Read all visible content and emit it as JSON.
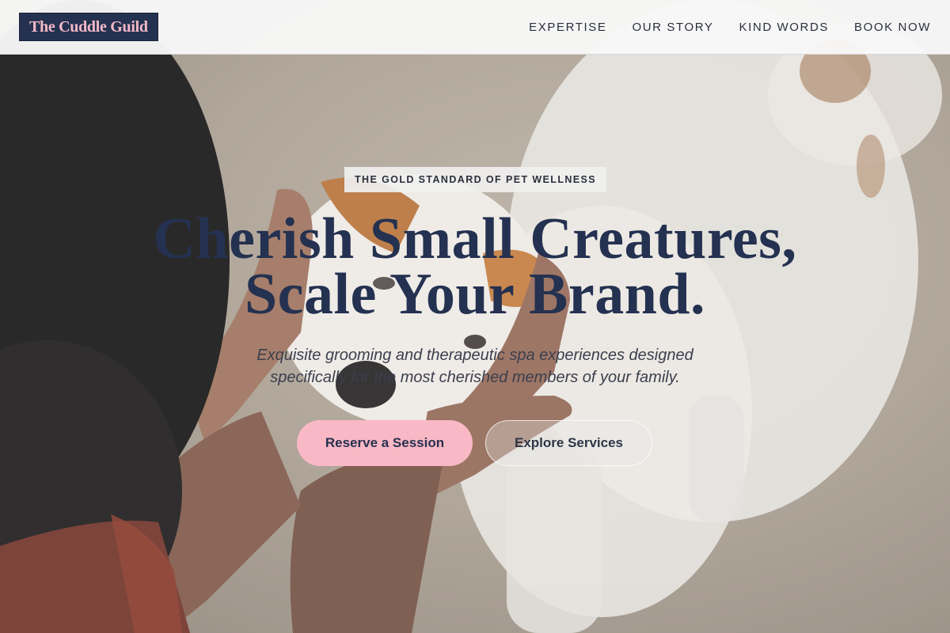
{
  "header": {
    "logo_text": "The Cuddle Guild",
    "nav": [
      {
        "label": "EXPERTISE"
      },
      {
        "label": "OUR STORY"
      },
      {
        "label": "KIND WORDS"
      },
      {
        "label": "BOOK NOW"
      }
    ]
  },
  "hero": {
    "eyebrow": "THE GOLD STANDARD OF PET WELLNESS",
    "headline_line1": "Cherish Small Creatures,",
    "headline_line2": "Scale Your Brand.",
    "subtitle_line1": "Exquisite grooming and therapeutic spa experiences designed",
    "subtitle_line2": "specifically for the most cherished members of your family.",
    "primary_button": "Reserve a Session",
    "secondary_button": "Explore Services",
    "background_image": "person-holding-puppy-photo"
  },
  "colors": {
    "brand_navy": "#243150",
    "brand_pink": "#f9b8c5",
    "logo_text_pink": "#f3b9c6"
  }
}
